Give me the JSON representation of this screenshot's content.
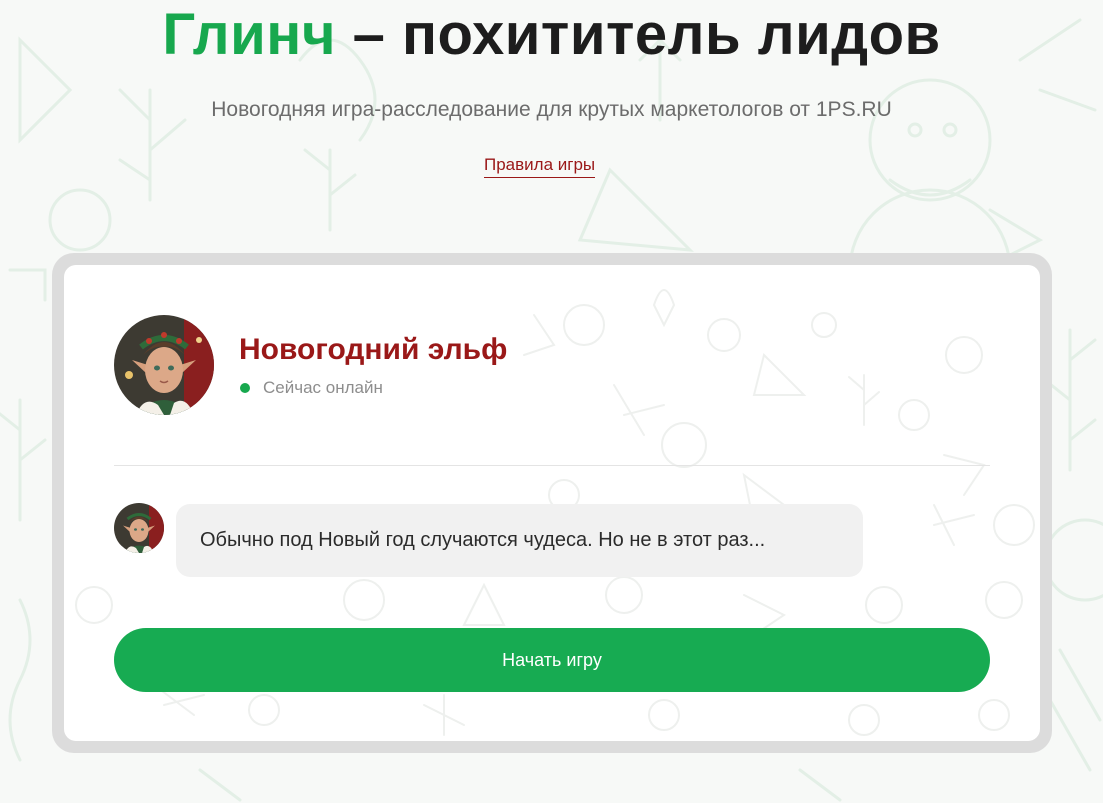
{
  "header": {
    "title_accent": "Глинч",
    "title_rest": " – похититель лидов",
    "subtitle": "Новогодняя игра-расследование для крутых маркетологов от 1PS.RU",
    "rules_link": "Правила игры"
  },
  "chat": {
    "bot_name": "Новогодний эльф",
    "status": "Сейчас онлайн",
    "messages": [
      {
        "text": "Обычно под Новый год случаются чудеса. Но не в этот раз..."
      }
    ],
    "start_button": "Начать игру"
  },
  "colors": {
    "accent_green": "#17a84e",
    "title_dark": "#1d1d1d",
    "name_red": "#9a1818",
    "card_border": "#dcdcdc",
    "bubble_bg": "#f1f1f1"
  },
  "icons": {
    "online_status": "green-dot-icon",
    "avatar": "elf-avatar-icon"
  }
}
